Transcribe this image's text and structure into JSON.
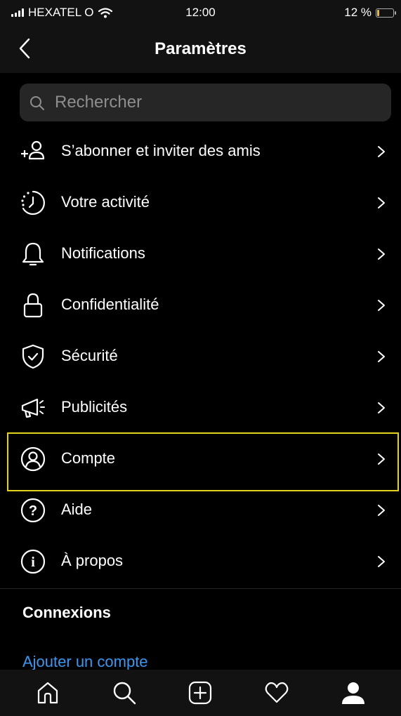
{
  "status_bar": {
    "carrier": "HEXATEL O",
    "time": "12:00",
    "battery": "12 %",
    "battery_level": 0.12,
    "battery_color": "#f2c200"
  },
  "header": {
    "title": "Paramètres",
    "back_icon": "chevron-left-icon"
  },
  "search": {
    "placeholder": "Rechercher",
    "icon": "search-icon"
  },
  "menu": {
    "items": [
      {
        "label": "S’abonner et inviter des amis",
        "icon": "add-person-icon"
      },
      {
        "label": "Votre activité",
        "icon": "activity-clock-icon"
      },
      {
        "label": "Notifications",
        "icon": "bell-icon"
      },
      {
        "label": "Confidentialité",
        "icon": "lock-icon"
      },
      {
        "label": "Sécurité",
        "icon": "shield-icon"
      },
      {
        "label": "Publicités",
        "icon": "megaphone-icon"
      },
      {
        "label": "Compte",
        "icon": "account-circle-icon",
        "highlighted": true
      },
      {
        "label": "Aide",
        "icon": "help-icon"
      },
      {
        "label": "À propos",
        "icon": "info-icon"
      }
    ]
  },
  "connections": {
    "title": "Connexions",
    "add_account": "Ajouter un compte"
  },
  "tab_bar": {
    "items": [
      "home-icon",
      "search-icon",
      "new-post-icon",
      "heart-icon",
      "profile-icon"
    ]
  },
  "colors": {
    "highlight": "#e4d21c",
    "link": "#3897f0",
    "background": "#000000"
  }
}
